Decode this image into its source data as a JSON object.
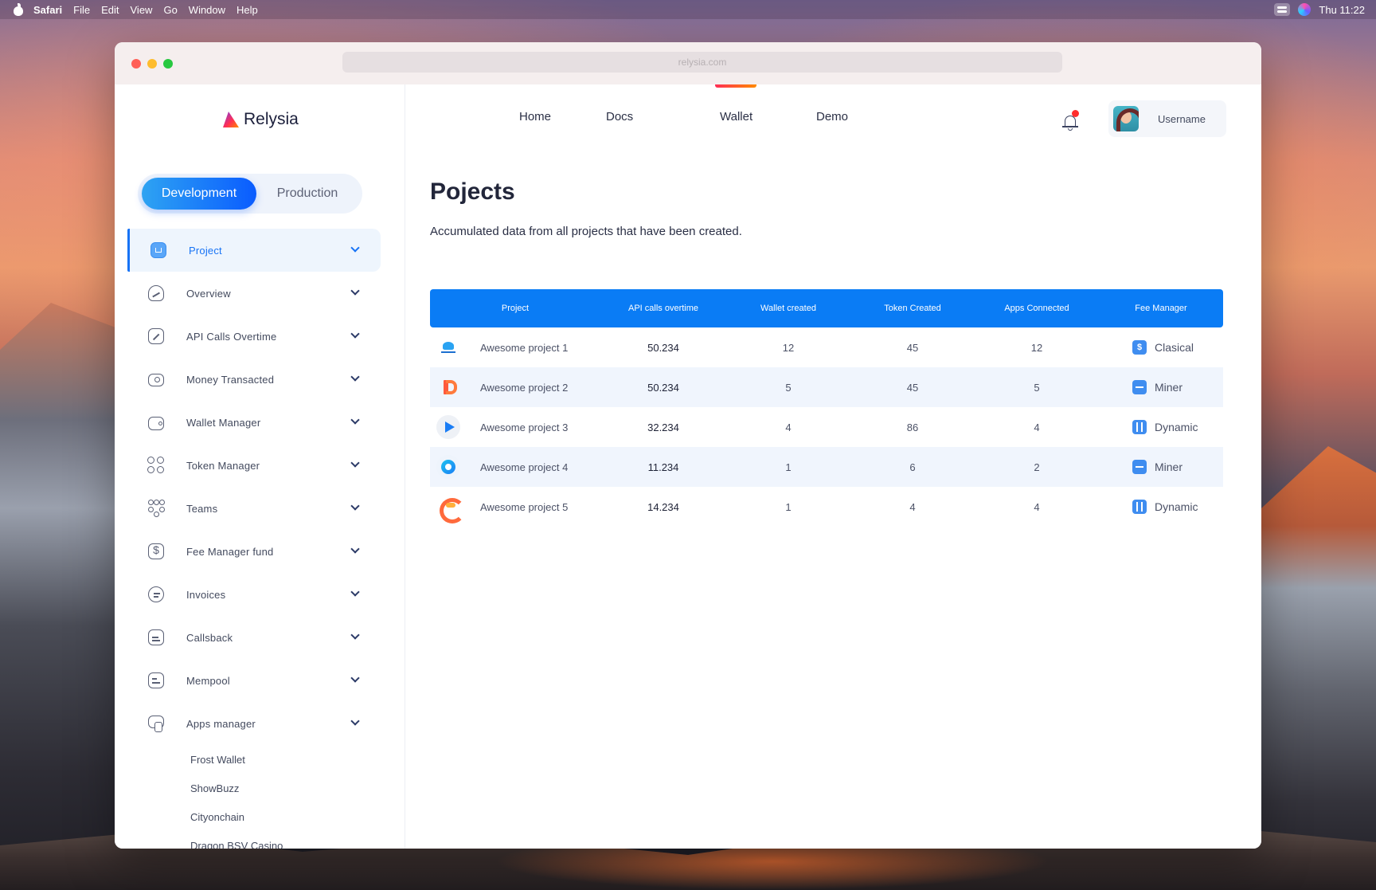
{
  "menubar": {
    "items": [
      "Safari",
      "File",
      "Edit",
      "View",
      "Go",
      "Window",
      "Help"
    ],
    "clock": "Thu 11:22"
  },
  "browser": {
    "url": "relysia.com"
  },
  "brand": {
    "name": "Relysia"
  },
  "env_switch": {
    "active": "Development",
    "inactive": "Production"
  },
  "sidebar": {
    "items": [
      {
        "label": "Project",
        "icon": "project-icon"
      },
      {
        "label": "Overview",
        "icon": "overview-icon"
      },
      {
        "label": "API Calls Overtime",
        "icon": "api-calls-icon"
      },
      {
        "label": "Money Transacted",
        "icon": "money-icon"
      },
      {
        "label": "Wallet Manager",
        "icon": "wallet-icon"
      },
      {
        "label": "Token Manager",
        "icon": "token-icon"
      },
      {
        "label": "Teams",
        "icon": "teams-icon"
      },
      {
        "label": "Fee Manager fund",
        "icon": "dollar-icon"
      },
      {
        "label": "Invoices",
        "icon": "invoice-icon"
      },
      {
        "label": "Callsback",
        "icon": "callback-icon"
      },
      {
        "label": "Mempool",
        "icon": "mempool-icon"
      },
      {
        "label": "Apps manager",
        "icon": "apps-icon"
      }
    ],
    "sub_items": [
      "Frost Wallet",
      "ShowBuzz",
      "Cityonchain",
      "Dragon BSV Casino"
    ]
  },
  "topnav": {
    "links": [
      "Home",
      "Docs",
      "Wallet",
      "Demo"
    ],
    "active": "Wallet",
    "username": "Username"
  },
  "page": {
    "title": "Pojects",
    "subtitle": "Accumulated data from all projects that have been created."
  },
  "table": {
    "headers": [
      "Project",
      "API calls overtime",
      "Wallet created",
      "Token Created",
      "Apps Connected",
      "Fee Manager"
    ],
    "rows": [
      {
        "project": "Awesome project 1",
        "api": "50.234",
        "wallets": "12",
        "tokens": "45",
        "apps": "12",
        "fee": "Clasical"
      },
      {
        "project": "Awesome project 2",
        "api": "50.234",
        "wallets": "5",
        "tokens": "45",
        "apps": "5",
        "fee": "Miner"
      },
      {
        "project": "Awesome project 3",
        "api": "32.234",
        "wallets": "4",
        "tokens": "86",
        "apps": "4",
        "fee": "Dynamic"
      },
      {
        "project": "Awesome project 4",
        "api": "11.234",
        "wallets": "1",
        "tokens": "6",
        "apps": "2",
        "fee": "Miner"
      },
      {
        "project": "Awesome project 5",
        "api": "14.234",
        "wallets": "1",
        "tokens": "4",
        "apps": "4",
        "fee": "Dynamic"
      }
    ]
  },
  "colors": {
    "accent": "#0a7cf5",
    "active_gradient_start": "#2ea3f2",
    "active_gradient_end": "#0a5cff",
    "notification": "#ff2d2d"
  }
}
